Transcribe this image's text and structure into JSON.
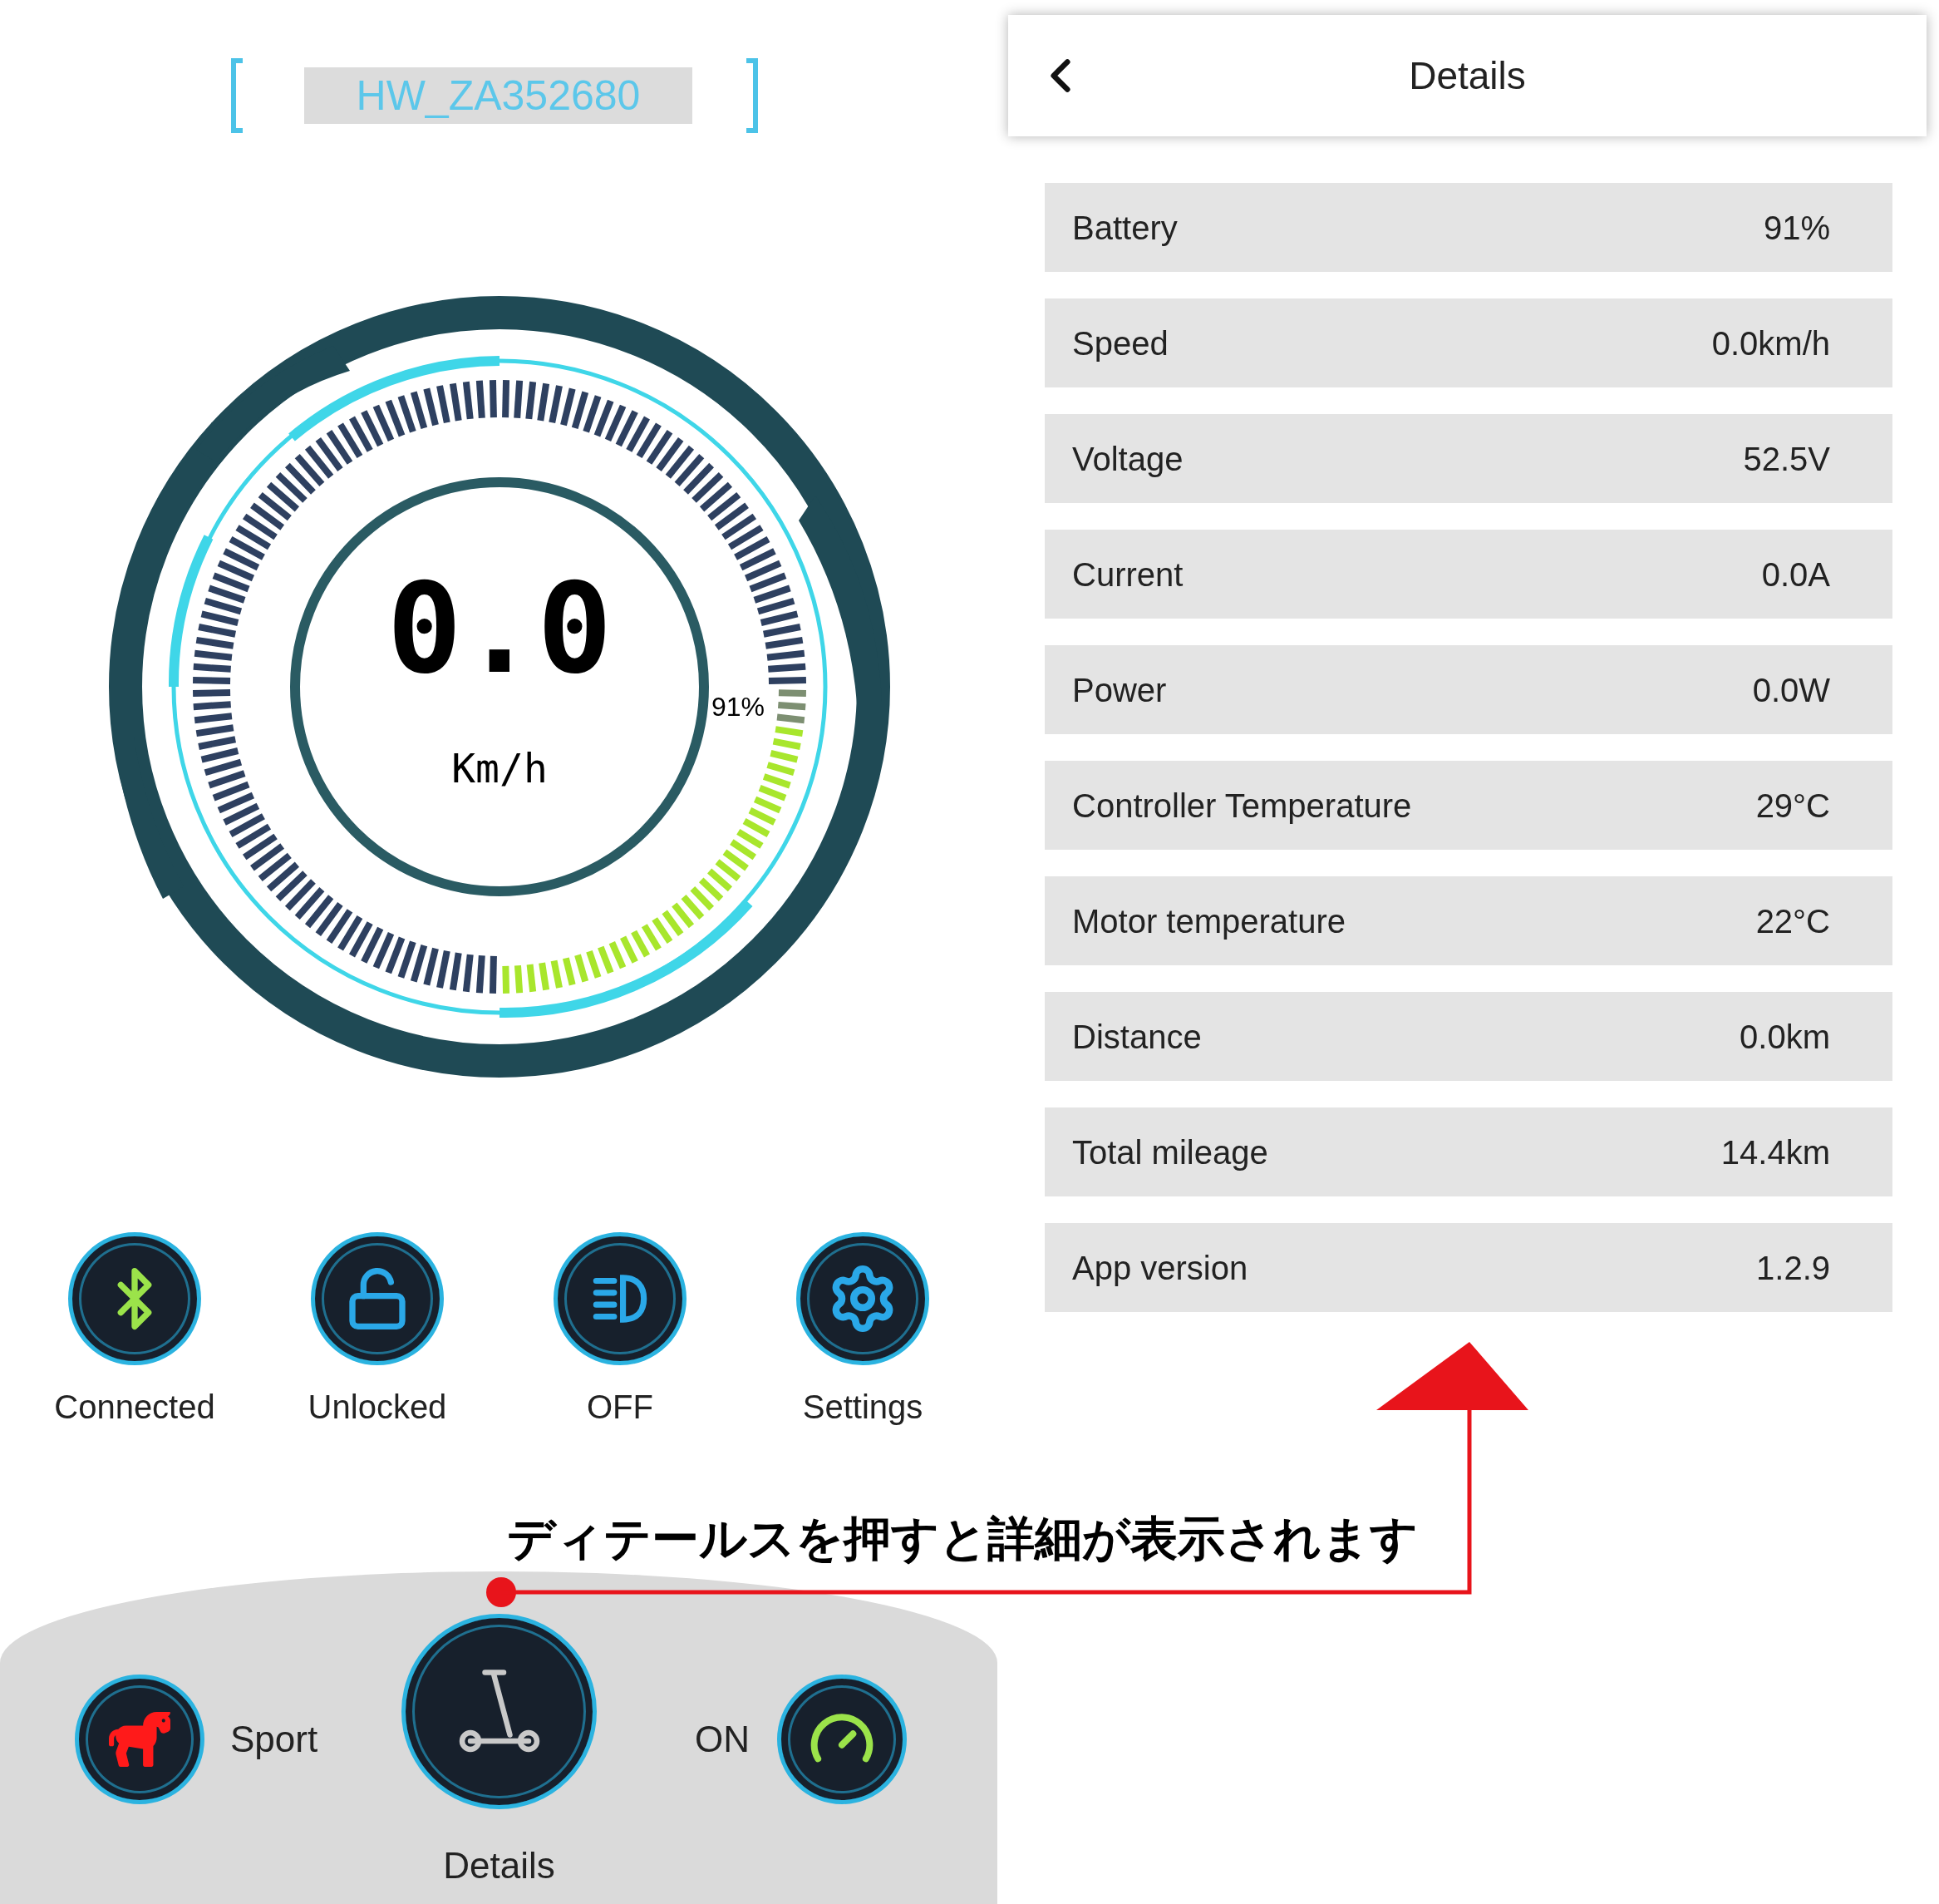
{
  "device": {
    "name": "HW_ZA352680"
  },
  "gauge": {
    "speed": "0.0",
    "unit": "Km/h",
    "battery_reading": "91%",
    "level": 0.91
  },
  "controls": [
    {
      "kind": "bluetooth",
      "label": "Connected"
    },
    {
      "kind": "lock",
      "label": "Unlocked"
    },
    {
      "kind": "headlight",
      "label": "OFF"
    },
    {
      "kind": "settings",
      "label": "Settings"
    }
  ],
  "annotation": {
    "text": "ディテールスを押すと詳細が表示されます"
  },
  "bottom_bar": {
    "mode": {
      "label": "Sport"
    },
    "details": {
      "label": "Details"
    },
    "cruise": {
      "label": "ON"
    }
  },
  "details_screen": {
    "title": "Details",
    "rows": [
      {
        "label": "Battery",
        "value": "91%"
      },
      {
        "label": "Speed",
        "value": "0.0km/h"
      },
      {
        "label": "Voltage",
        "value": "52.5V"
      },
      {
        "label": "Current",
        "value": "0.0A"
      },
      {
        "label": "Power",
        "value": "0.0W"
      },
      {
        "label": "Controller Temperature",
        "value": "29°C"
      },
      {
        "label": "Motor temperature",
        "value": "22°C"
      },
      {
        "label": "Distance",
        "value": "0.0km"
      },
      {
        "label": "Total mileage",
        "value": "14.4km"
      },
      {
        "label": "App version",
        "value": "1.2.9"
      }
    ]
  }
}
